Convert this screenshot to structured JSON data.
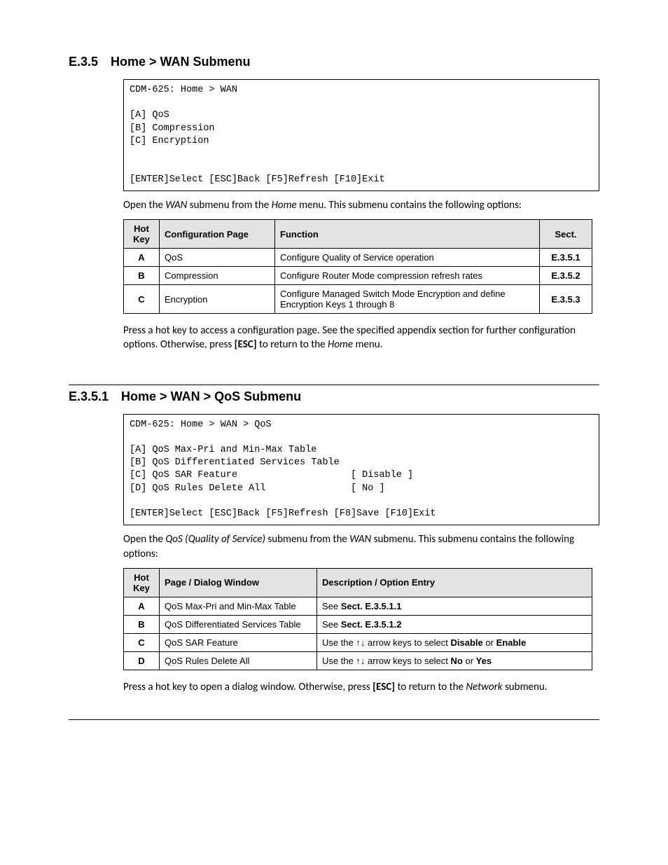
{
  "section1": {
    "num": "E.3.5",
    "title": "Home > WAN Submenu",
    "term": "CDM-625: Home > WAN\n\n[A] QoS\n[B] Compression\n[C] Encryption\n\n\n[ENTER]Select [ESC]Back [F5]Refresh [F10]Exit",
    "intro_a": "Open the ",
    "intro_b": "WAN",
    "intro_c": " submenu from the ",
    "intro_d": "Home",
    "intro_e": " menu. This submenu contains the following options:",
    "tbl": {
      "h1": "Hot Key",
      "h2": "Configuration Page",
      "h3": "Function",
      "h4": "Sect.",
      "rows": [
        {
          "k": "A",
          "p": "QoS",
          "f": "Configure Quality of Service operation",
          "s": "E.3.5.1"
        },
        {
          "k": "B",
          "p": "Compression",
          "f": "Configure Router Mode compression refresh rates",
          "s": "E.3.5.2"
        },
        {
          "k": "C",
          "p": "Encryption",
          "f": "Configure Managed Switch Mode Encryption and define Encryption Keys 1 through 8",
          "s": "E.3.5.3"
        }
      ]
    },
    "out_a": "Press a hot key to access a configuration page. See the specified appendix section for further configuration options. Otherwise, press ",
    "out_b": "[ESC]",
    "out_c": " to return to the ",
    "out_d": "Home",
    "out_e": " menu."
  },
  "section2": {
    "num": "E.3.5.1",
    "title": "Home > WAN > QoS Submenu",
    "term": "CDM-625: Home > WAN > QoS\n\n[A] QoS Max-Pri and Min-Max Table\n[B] QoS Differentiated Services Table\n[C] QoS SAR Feature                    [ Disable ]\n[D] QoS Rules Delete All               [ No ]\n\n[ENTER]Select [ESC]Back [F5]Refresh [F8]Save [F10]Exit",
    "intro_a": "Open the ",
    "intro_b": "QoS (Quality of Service)",
    "intro_c": " submenu from the ",
    "intro_d": "WAN",
    "intro_e": " submenu. This submenu contains the following options:",
    "tbl": {
      "h1": "Hot Key",
      "h2": "Page / Dialog Window",
      "h3": "Description / Option Entry",
      "rows": [
        {
          "k": "A",
          "p": "QoS Max-Pri and Min-Max Table",
          "d_pre": "See ",
          "d_b": "Sect. E.3.5.1.1",
          "d_post": ""
        },
        {
          "k": "B",
          "p": "QoS Differentiated Services Table",
          "d_pre": "See ",
          "d_b": "Sect. E.3.5.1.2",
          "d_post": ""
        },
        {
          "k": "C",
          "p": "QoS SAR Feature",
          "d_pre": "Use the ↑↓ arrow keys to select ",
          "d_b": "Disable",
          "d_mid": " or ",
          "d_b2": "Enable"
        },
        {
          "k": "D",
          "p": "QoS Rules Delete All",
          "d_pre": "Use the ↑↓ arrow keys to select ",
          "d_b": "No",
          "d_mid": " or ",
          "d_b2": "Yes"
        }
      ]
    },
    "out_a": "Press a hot key to open a dialog window. Otherwise, press ",
    "out_b": "[ESC]",
    "out_c": " to return to the ",
    "out_d": "Network",
    "out_e": " submenu."
  }
}
